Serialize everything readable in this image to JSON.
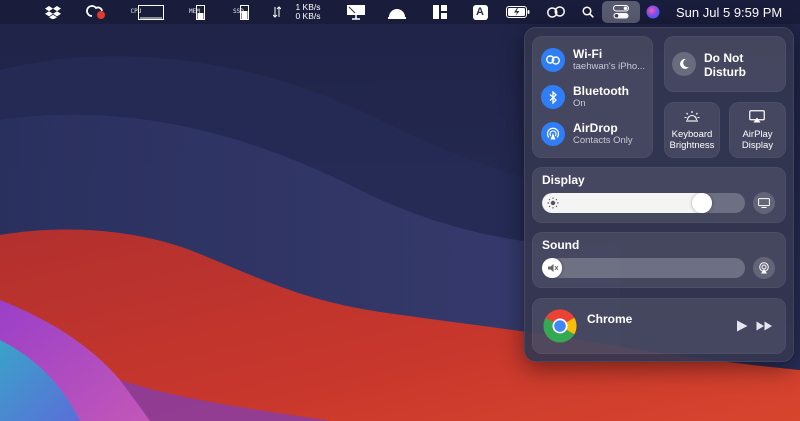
{
  "menubar": {
    "cpu_label": "CPU",
    "mem_label": "MEM",
    "ssd_label": "SSD",
    "net_up": "1 KB/s",
    "net_down": "0 KB/s",
    "input_source": "A",
    "datetime": "Sun Jul 5  9:59 PM"
  },
  "control_center": {
    "wifi": {
      "title": "Wi-Fi",
      "subtitle": "taehwan's iPho..."
    },
    "bluetooth": {
      "title": "Bluetooth",
      "subtitle": "On"
    },
    "airdrop": {
      "title": "AirDrop",
      "subtitle": "Contacts Only"
    },
    "dnd": {
      "line1": "Do Not",
      "line2": "Disturb"
    },
    "keyboard_brightness": {
      "line1": "Keyboard",
      "line2": "Brightness"
    },
    "airplay_display": {
      "line1": "AirPlay",
      "line2": "Display"
    },
    "display": {
      "title": "Display",
      "brightness": 0.82
    },
    "sound": {
      "title": "Sound",
      "volume": 0.0
    },
    "now_playing": {
      "app": "Chrome"
    }
  },
  "colors": {
    "accent_blue": "#2f7ef5",
    "panel_bg": "#343650"
  }
}
